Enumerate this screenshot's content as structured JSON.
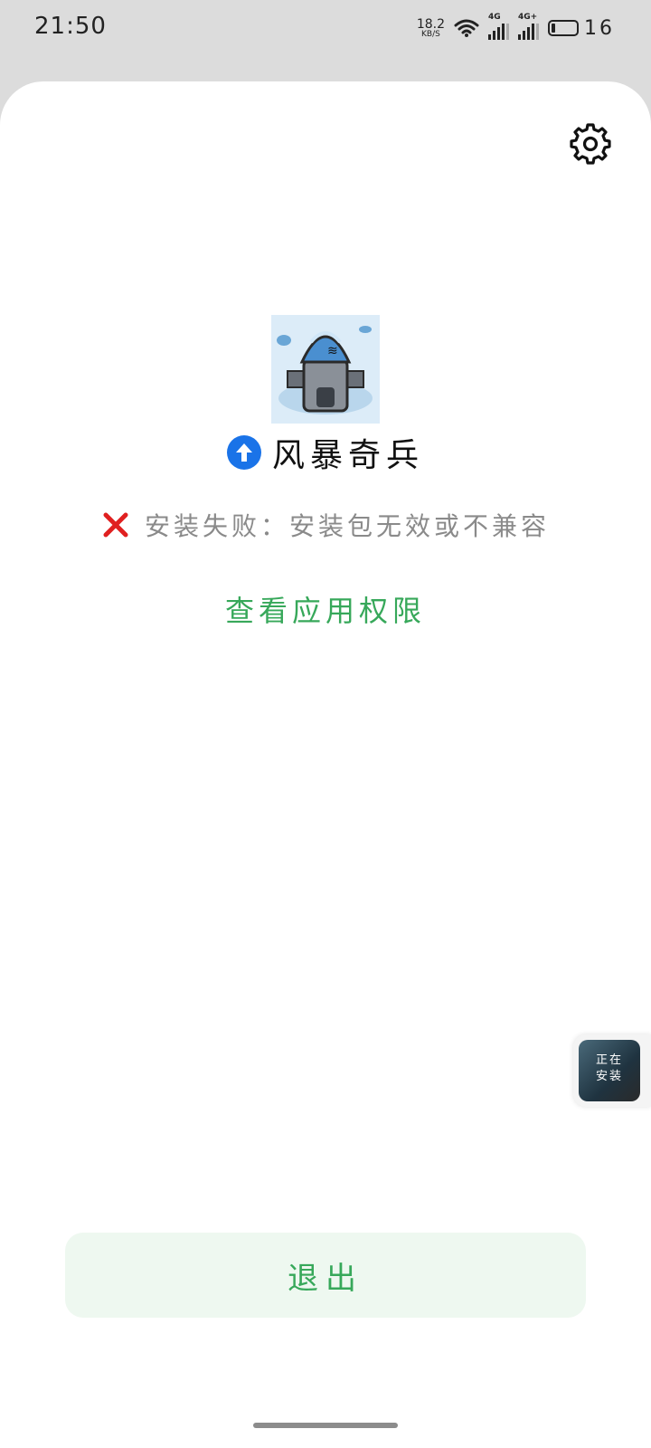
{
  "status_bar": {
    "time": "21:50",
    "net_speed_value": "18.2",
    "net_speed_unit": "KB/S",
    "sim1_tag": "4G",
    "sim2_tag": "4G+",
    "battery_level": "16"
  },
  "install": {
    "app_name": "风暴奇兵",
    "error_message": "安装失败：安装包无效或不兼容",
    "permissions_link": "查看应用权限",
    "exit_label": "退出",
    "floating_label_line1": "正在",
    "floating_label_line2": "安装"
  },
  "colors": {
    "accent_green": "#37a85a",
    "error_red": "#e02020",
    "upload_blue": "#1a73e8",
    "exit_bg": "#eef8f0"
  },
  "icons": {
    "settings": "gear-icon",
    "app": "app-icon",
    "upload": "upload-arrow-icon",
    "error": "close-x-icon"
  }
}
